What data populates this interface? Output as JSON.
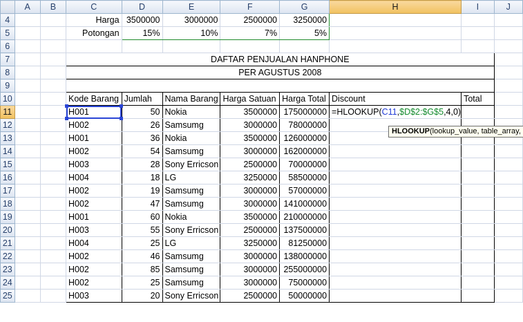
{
  "columns": [
    "A",
    "B",
    "C",
    "D",
    "E",
    "F",
    "G",
    "H",
    "I",
    "J"
  ],
  "rows": {
    "r4": {
      "num": "4",
      "label": "Harga",
      "vals": [
        "3500000",
        "3000000",
        "2500000",
        "3250000"
      ]
    },
    "r5": {
      "num": "5",
      "label": "Potongan",
      "vals": [
        "15%",
        "10%",
        "7%",
        "5%"
      ]
    },
    "r6": {
      "num": "6"
    },
    "r7": {
      "num": "7",
      "title": "DAFTAR PENJUALAN HANPHONE"
    },
    "r8": {
      "num": "8",
      "title": "PER AGUSTUS 2008"
    },
    "r9": {
      "num": "9"
    },
    "r10": {
      "num": "10",
      "headers": [
        "Kode Barang",
        "Jumlah",
        "Nama Barang",
        "Harga Satuan",
        "Harga Total",
        "Discount",
        "Total"
      ]
    }
  },
  "data_rows": [
    {
      "num": "11",
      "kode": "H001",
      "jumlah": "50",
      "nama": "Nokia",
      "satuan": "3500000",
      "total": "175000000"
    },
    {
      "num": "12",
      "kode": "H002",
      "jumlah": "26",
      "nama": "Samsumg",
      "satuan": "3000000",
      "total": "78000000"
    },
    {
      "num": "13",
      "kode": "H001",
      "jumlah": "36",
      "nama": "Nokia",
      "satuan": "3500000",
      "total": "126000000"
    },
    {
      "num": "14",
      "kode": "H002",
      "jumlah": "54",
      "nama": "Samsumg",
      "satuan": "3000000",
      "total": "162000000"
    },
    {
      "num": "15",
      "kode": "H003",
      "jumlah": "28",
      "nama": "Sony Erricson",
      "satuan": "2500000",
      "total": "70000000"
    },
    {
      "num": "16",
      "kode": "H004",
      "jumlah": "18",
      "nama": "LG",
      "satuan": "3250000",
      "total": "58500000"
    },
    {
      "num": "17",
      "kode": "H002",
      "jumlah": "19",
      "nama": "Samsumg",
      "satuan": "3000000",
      "total": "57000000"
    },
    {
      "num": "18",
      "kode": "H002",
      "jumlah": "47",
      "nama": "Samsumg",
      "satuan": "3000000",
      "total": "141000000"
    },
    {
      "num": "19",
      "kode": "H001",
      "jumlah": "60",
      "nama": "Nokia",
      "satuan": "3500000",
      "total": "210000000"
    },
    {
      "num": "20",
      "kode": "H003",
      "jumlah": "55",
      "nama": "Sony Erricson",
      "satuan": "2500000",
      "total": "137500000"
    },
    {
      "num": "21",
      "kode": "H004",
      "jumlah": "25",
      "nama": "LG",
      "satuan": "3250000",
      "total": "81250000"
    },
    {
      "num": "22",
      "kode": "H002",
      "jumlah": "46",
      "nama": "Samsumg",
      "satuan": "3000000",
      "total": "138000000"
    },
    {
      "num": "23",
      "kode": "H002",
      "jumlah": "85",
      "nama": "Samsumg",
      "satuan": "3000000",
      "total": "255000000"
    },
    {
      "num": "24",
      "kode": "H002",
      "jumlah": "25",
      "nama": "Samsumg",
      "satuan": "3000000",
      "total": "75000000"
    },
    {
      "num": "25",
      "kode": "H003",
      "jumlah": "20",
      "nama": "Sony Erricson",
      "satuan": "2500000",
      "total": "50000000"
    }
  ],
  "formula": {
    "prefix": "=HLOOKUP(",
    "ref1": "C11",
    "sep1": ",",
    "ref2": "$D$2:$G$5",
    "suffix": ",4,0)"
  },
  "tooltip": {
    "func": "HLOOKUP",
    "args": "(lookup_value, table_array, row_index_num, [range_lookup])"
  },
  "colors": {
    "selection": "#2a45d6",
    "range_highlight": "#138a2c",
    "formula_ref": "#1f3ad6"
  }
}
